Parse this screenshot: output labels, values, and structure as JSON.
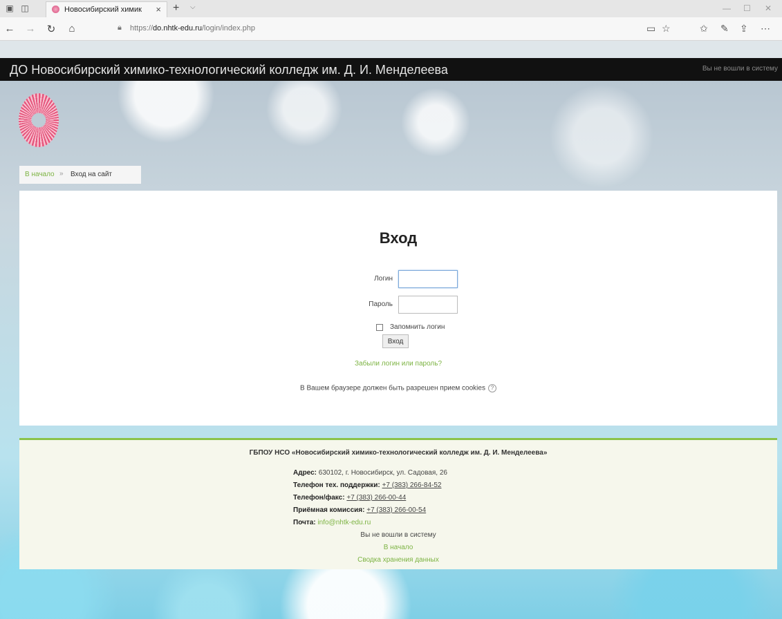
{
  "browser": {
    "tab_title": "Новосибирский химик",
    "url_prefix": "https://",
    "url_host": "do.nhtk-edu.ru",
    "url_path": "/login/index.php"
  },
  "site": {
    "name": "ДО Новосибирский химико-технологический колледж им. Д. И. Менделеева",
    "top_status": "Вы не вошли в систему"
  },
  "breadcrumb": {
    "home": "В начало",
    "separator": "»",
    "current": "Вход на сайт"
  },
  "login": {
    "heading": "Вход",
    "username_label": "Логин",
    "username_value": "",
    "password_label": "Пароль",
    "remember_label": "Запомнить логин",
    "submit_label": "Вход",
    "forgot_link": "Забыли логин или пароль?",
    "cookies_notice": "В Вашем браузере должен быть разрешен прием cookies"
  },
  "footer": {
    "org": "ГБПОУ НСО «Новосибирский химико-технологический колледж им. Д. И. Менделеева»",
    "address_label": "Адрес:",
    "address_value": "630102, г. Новосибирск, ул. Садовая, 26",
    "support_label": "Телефон тех. поддержки:",
    "support_value": "+7 (383) 266-84-52",
    "phonefax_label": "Телефон/факс:",
    "phonefax_value": "+7 (383) 266-00-44",
    "admission_label": "Приёмная комиссия:",
    "admission_value": "+7 (383) 266-00-54",
    "email_label": "Почта:",
    "email_value": "info@nhtk-edu.ru",
    "not_logged": "Вы не вошли в систему",
    "home_link": "В начало",
    "data_retention": "Сводка хранения данных"
  },
  "colors": {
    "accent": "#7cb342",
    "sitebar": "#111111",
    "footer_border": "#8bc34a"
  }
}
